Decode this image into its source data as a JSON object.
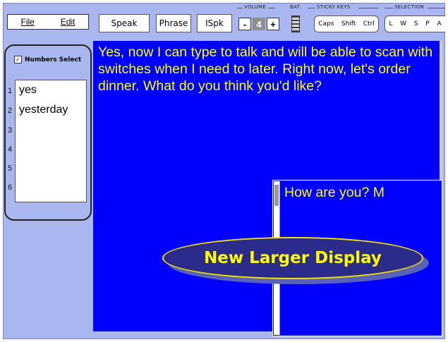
{
  "menu": {
    "file": "File",
    "edit": "Edit"
  },
  "toolbar": {
    "speak": "Speak",
    "phrase": "Phrase",
    "ispk": "ISpk"
  },
  "volume": {
    "label": "VOLUME",
    "minus": "-",
    "value": "4",
    "plus": "+"
  },
  "battery": {
    "label": "BAT."
  },
  "sticky_keys": {
    "label": "STICKY KEYS",
    "items": [
      "Caps",
      "Shift",
      "Ctrl"
    ]
  },
  "selection": {
    "label": "SELECTION",
    "items": [
      "L",
      "W",
      "S",
      "P",
      "A"
    ]
  },
  "prediction": {
    "numbers_select_label": "Numbers Select",
    "numbers_select_checked": true,
    "numbers": [
      "1",
      "2",
      "3",
      "4",
      "5",
      "6"
    ],
    "words": [
      "yes",
      "yesterday",
      "",
      "",
      "",
      ""
    ]
  },
  "main_display": {
    "text": "Yes, now I can type to talk and will be able to scan with switches when I need to later. Right now,  let's order dinner. What do you think you'd like?",
    "bg_color": "#0000ff",
    "text_color": "#ffff00"
  },
  "second_display": {
    "text": "How are you? M"
  },
  "callout": {
    "text": "New Larger Display"
  }
}
